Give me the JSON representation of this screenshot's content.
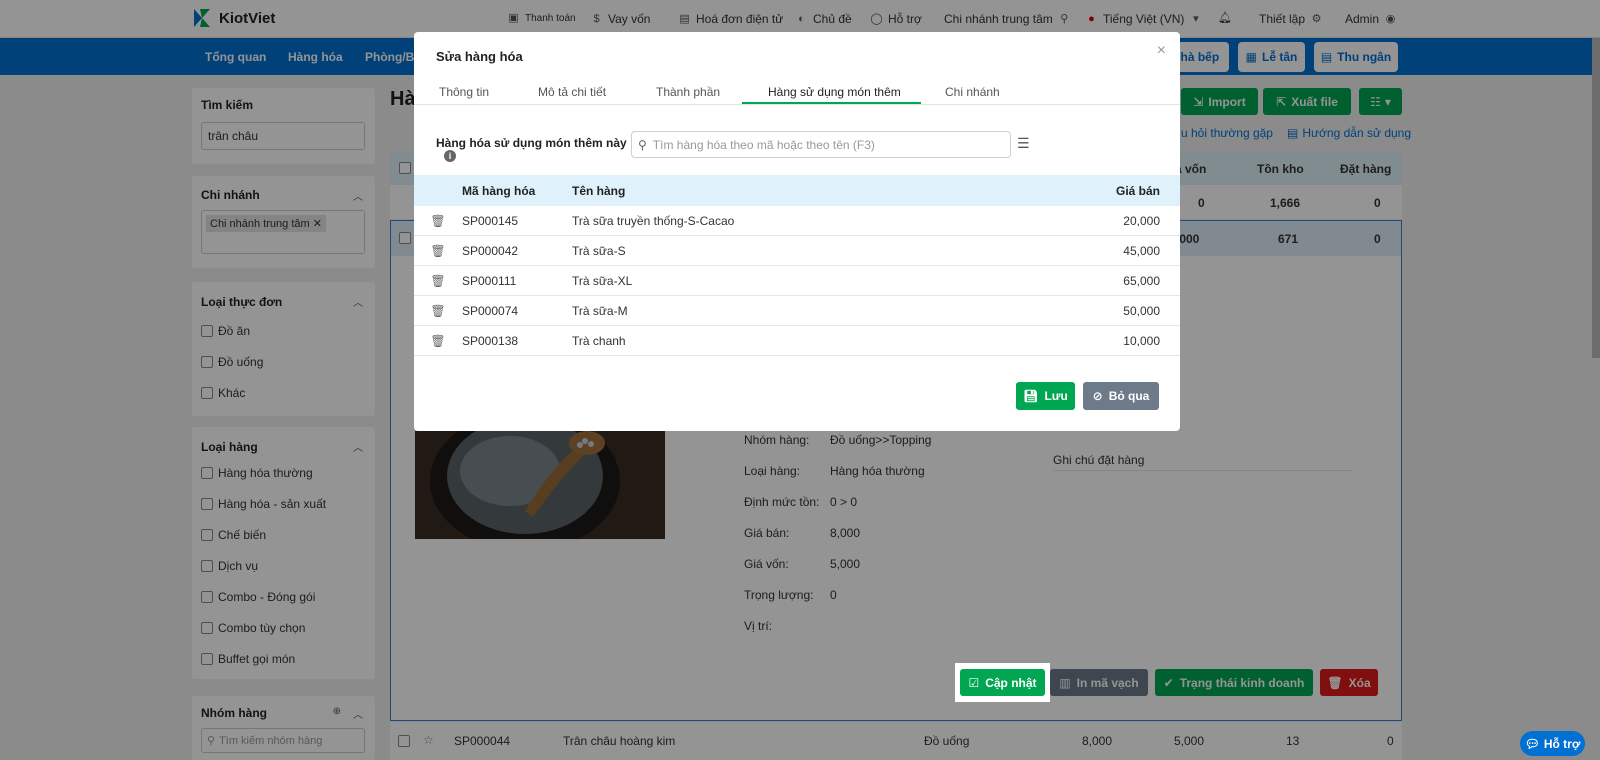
{
  "app": {
    "name": "KiotViet"
  },
  "topbar": {
    "payment": "Thanh toán",
    "loan": "Vay vốn",
    "einvoice": "Hoá đơn điện tử",
    "theme": "Chủ đề",
    "support": "Hỗ trợ",
    "branch": "Chi nhánh trung tâm",
    "language": "Tiếng Việt (VN)",
    "settings": "Thiết lập",
    "user": "Admin"
  },
  "nav": {
    "items": [
      "Tổng quan",
      "Hàng hóa",
      "Phòng/Bà"
    ],
    "kitchen": "Nhà bếp",
    "reception": "Lễ tân",
    "cashier": "Thu ngân"
  },
  "page": {
    "title_partial": "Hà",
    "import": "Import",
    "export": "Xuất file",
    "faq": "u hỏi thường gặp",
    "guide": "Hướng dẫn sử dụng",
    "col_cost": "á vốn",
    "col_stock": "Tồn kho",
    "col_order": "Đặt hàng",
    "summary": {
      "cost": "0",
      "stock": "1,666",
      "order": "0"
    },
    "selected_row": {
      "cost": ",000",
      "stock": "671",
      "order": "0"
    }
  },
  "sidebar": {
    "search_title": "Tìm kiếm",
    "search_value": "trân châu",
    "branch_title": "Chi nhánh",
    "branch_tag": "Chi nhánh trung tâm",
    "menu_type_title": "Loại thực đơn",
    "menu_types": [
      "Đồ ăn",
      "Đồ uống",
      "Khác"
    ],
    "product_type_title": "Loại hàng",
    "product_types": [
      "Hàng hóa thường",
      "Hàng hóa - sản xuất",
      "Chế biến",
      "Dịch vụ",
      "Combo - Đóng gói",
      "Combo tùy chọn",
      "Buffet gọi món"
    ],
    "group_title": "Nhóm hàng",
    "group_search_placeholder": "Tìm kiếm nhóm hàng"
  },
  "detail": {
    "rows": [
      {
        "label": "Nhóm hàng:",
        "value": "Đồ uống>>Topping"
      },
      {
        "label": "Loại hàng:",
        "value": "Hàng hóa thường"
      },
      {
        "label": "Định mức tồn:",
        "value": "0  >  0"
      },
      {
        "label": "Giá bán:",
        "value": "8,000"
      },
      {
        "label": "Giá vốn:",
        "value": "5,000"
      },
      {
        "label": "Trọng lượng:",
        "value": "0"
      },
      {
        "label": "Vị trí:",
        "value": ""
      }
    ],
    "order_note": "Ghi chú đặt hàng",
    "btn_update": "Cập nhật",
    "btn_barcode": "In mã vạch",
    "btn_status": "Trạng thái kinh doanh",
    "btn_delete": "Xóa"
  },
  "bottom_row": {
    "code": "SP000044",
    "name": "Trân châu hoàng kim",
    "group": "Đồ uống",
    "price": "8,000",
    "cost": "5,000",
    "stock": "13",
    "order": "0"
  },
  "help_button": "Hỗ trợ",
  "modal": {
    "title": "Sửa hàng hóa",
    "tabs": [
      "Thông tin",
      "Mô tả chi tiết",
      "Thành phần",
      "Hàng sử dụng món thêm",
      "Chi nhánh"
    ],
    "active_tab": 3,
    "label": "Hàng hóa sử dụng món thêm này",
    "search_placeholder": "Tìm hàng hóa theo mã hoặc theo tên (F3)",
    "columns": {
      "code": "Mã hàng hóa",
      "name": "Tên hàng",
      "price": "Giá bán"
    },
    "rows": [
      {
        "code": "SP000145",
        "name": "Trà sữa truyền thống-S-Cacao",
        "price": "20,000"
      },
      {
        "code": "SP000042",
        "name": "Trà sữa-S",
        "price": "45,000"
      },
      {
        "code": "SP000111",
        "name": "Trà sữa-XL",
        "price": "65,000"
      },
      {
        "code": "SP000074",
        "name": "Trà sữa-M",
        "price": "50,000"
      },
      {
        "code": "SP000138",
        "name": "Trà chanh",
        "price": "10,000"
      }
    ],
    "save": "Lưu",
    "skip": "Bỏ qua"
  },
  "colors": {
    "primary": "#0070d2",
    "green": "#00a651",
    "red": "#e01b1b",
    "gray_btn": "#6c7a8a"
  }
}
